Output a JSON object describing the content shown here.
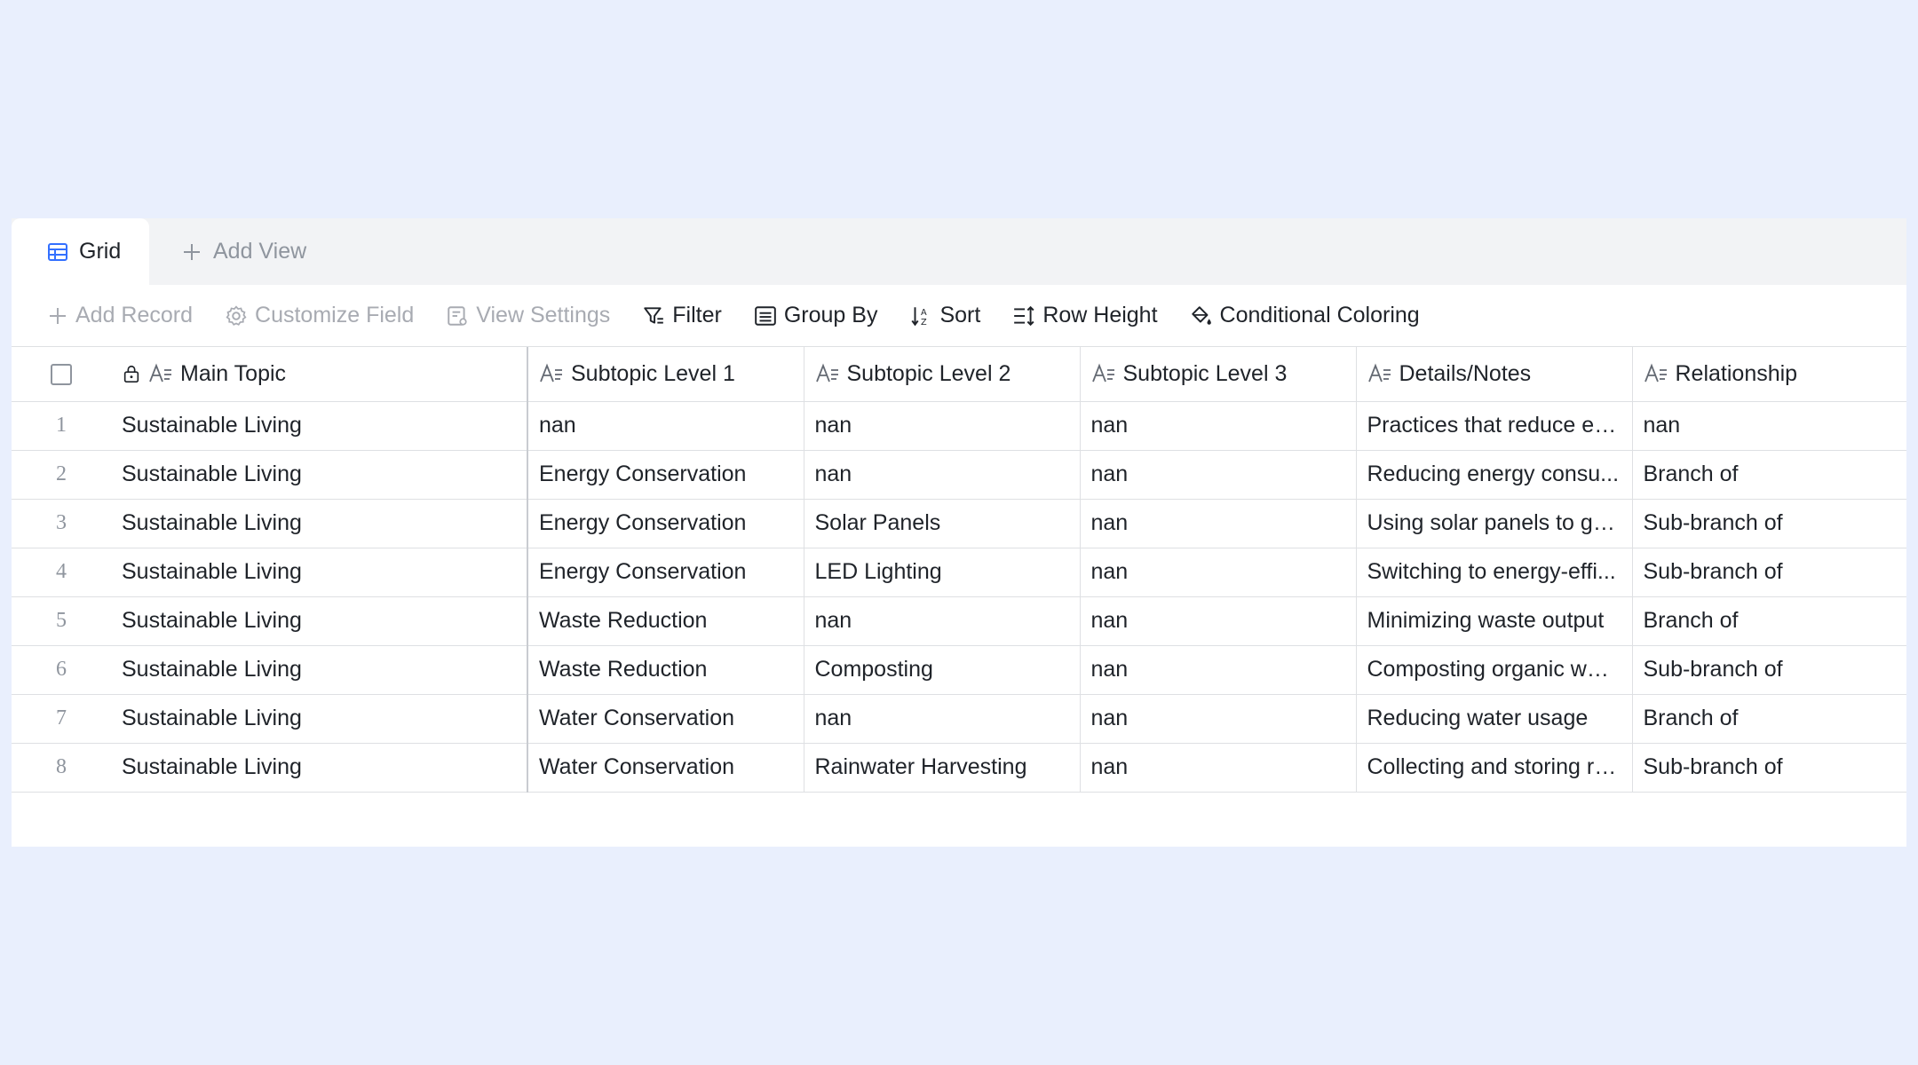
{
  "tabs": {
    "grid_label": "Grid",
    "add_view_label": "Add View"
  },
  "toolbar": {
    "add_record": "Add Record",
    "customize_field": "Customize Field",
    "view_settings": "View Settings",
    "filter": "Filter",
    "group_by": "Group By",
    "sort": "Sort",
    "row_height": "Row Height",
    "conditional_coloring": "Conditional Coloring"
  },
  "columns": [
    "Main Topic",
    "Subtopic Level 1",
    "Subtopic Level 2",
    "Subtopic Level 3",
    "Details/Notes",
    "Relationship"
  ],
  "rows": [
    {
      "num": "1",
      "cells": [
        "Sustainable Living",
        "nan",
        "nan",
        "nan",
        "Practices that reduce en...",
        "nan"
      ]
    },
    {
      "num": "2",
      "cells": [
        "Sustainable Living",
        "Energy Conservation",
        "nan",
        "nan",
        "Reducing energy consu...",
        "Branch of"
      ]
    },
    {
      "num": "3",
      "cells": [
        "Sustainable Living",
        "Energy Conservation",
        "Solar Panels",
        "nan",
        "Using solar panels to ge...",
        "Sub-branch of"
      ]
    },
    {
      "num": "4",
      "cells": [
        "Sustainable Living",
        "Energy Conservation",
        "LED Lighting",
        "nan",
        "Switching to energy-effi...",
        "Sub-branch of"
      ]
    },
    {
      "num": "5",
      "cells": [
        "Sustainable Living",
        "Waste Reduction",
        "nan",
        "nan",
        "Minimizing waste output",
        "Branch of"
      ]
    },
    {
      "num": "6",
      "cells": [
        "Sustainable Living",
        "Waste Reduction",
        "Composting",
        "nan",
        "Composting organic waste",
        "Sub-branch of"
      ]
    },
    {
      "num": "7",
      "cells": [
        "Sustainable Living",
        "Water Conservation",
        "nan",
        "nan",
        "Reducing water usage",
        "Branch of"
      ]
    },
    {
      "num": "8",
      "cells": [
        "Sustainable Living",
        "Water Conservation",
        "Rainwater Harvesting",
        "nan",
        "Collecting and storing ra...",
        "Sub-branch of"
      ]
    }
  ],
  "colors": {
    "background": "#e9effd",
    "accent": "#3370ff",
    "muted": "#a8abb2"
  }
}
